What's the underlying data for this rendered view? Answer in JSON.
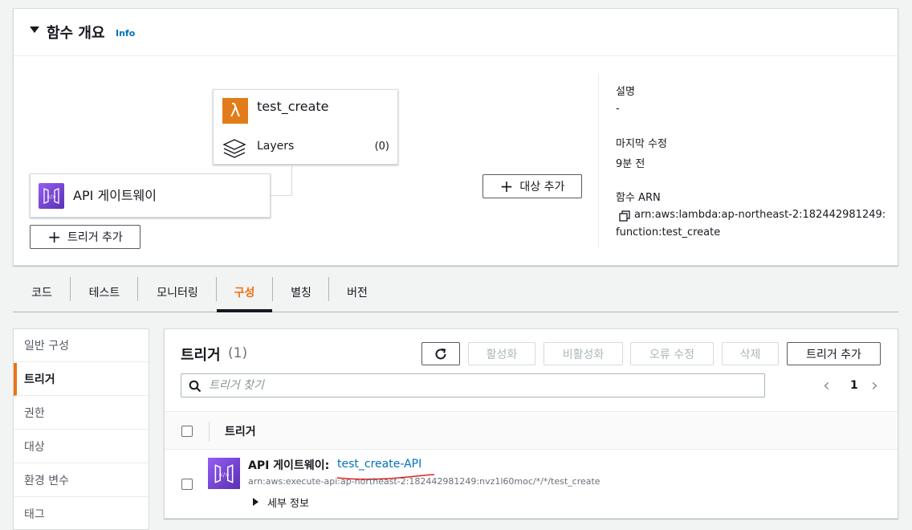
{
  "overview": {
    "title": "함수 개요",
    "info": "Info",
    "function": {
      "name": "test_create",
      "layers_label": "Layers",
      "layers_count": "(0)"
    },
    "trigger_card": {
      "name": "API 게이트웨이"
    },
    "add_trigger_label": "트리거 추가",
    "add_destination_label": "대상 추가",
    "description_label": "설명",
    "description_value": "-",
    "last_modified_label": "마지막 수정",
    "last_modified_value": "9분 전",
    "arn_label": "함수 ARN",
    "arn_line1": "arn:aws:lambda:ap-northeast-2:182442981249:",
    "arn_line2": "function:test_create"
  },
  "tabs": [
    "코드",
    "테스트",
    "모니터링",
    "구성",
    "별칭",
    "버전"
  ],
  "active_tab": "구성",
  "sidenav": [
    "일반 구성",
    "트리거",
    "권한",
    "대상",
    "환경 변수",
    "태그"
  ],
  "active_nav": "트리거",
  "triggers": {
    "title": "트리거",
    "count": "(1)",
    "buttons": {
      "enable": "활성화",
      "disable": "비활성화",
      "fix_errors": "오류 수정",
      "delete": "삭제",
      "add": "트리거 추가"
    },
    "search_placeholder": "트리거 찾기",
    "page": "1",
    "column_header": "트리거",
    "row": {
      "title": "API 게이트웨이:",
      "link": "test_create-API",
      "arn": "arn:aws:execute-api:ap-northeast-2:182442981249:nvz1l60moc/*/*/test_create",
      "details": "세부 정보"
    }
  },
  "colors": {
    "accent": "#ec7211",
    "link": "#0073bb",
    "lambda": "#e27b19",
    "api_gateway": "#7b45d6"
  }
}
